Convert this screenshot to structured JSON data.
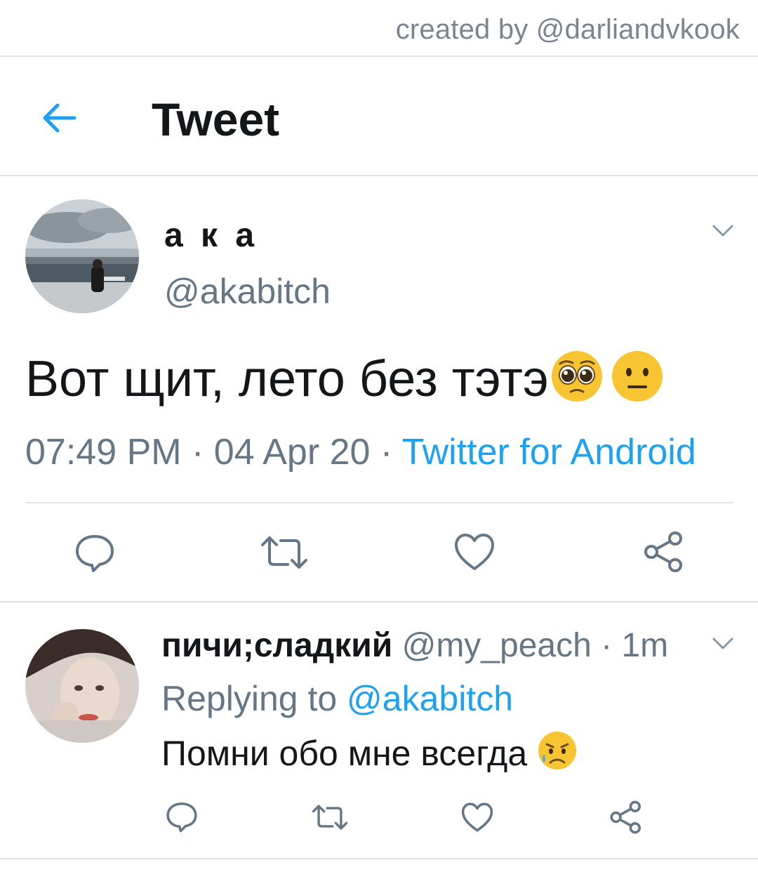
{
  "watermark": "created by @darliandvkook",
  "header": {
    "title": "Tweet",
    "back_icon": "arrow-left-icon"
  },
  "tweet": {
    "display_name": "а к а",
    "handle": "@akabitch",
    "text": "Вот щит, лето без тэтэ",
    "emojis": [
      "pleading-face",
      "neutral-face"
    ],
    "time": "07:49 PM",
    "date": "04 Apr 20",
    "separator": " · ",
    "source": "Twitter for Android",
    "actions": [
      "reply-icon",
      "retweet-icon",
      "like-icon",
      "share-icon"
    ]
  },
  "reply": {
    "display_name": "пичи;сладкий",
    "handle": "@my_peach",
    "age": "1m",
    "replying_prefix": "Replying to ",
    "replying_to": "@akabitch",
    "text": "Помни обо мне всегда",
    "emoji": "sad-but-relieved-face"
  },
  "colors": {
    "accent": "#1da1f2",
    "secondary_text": "#657786",
    "divider": "#dfe3e6",
    "icon": "#657786"
  }
}
